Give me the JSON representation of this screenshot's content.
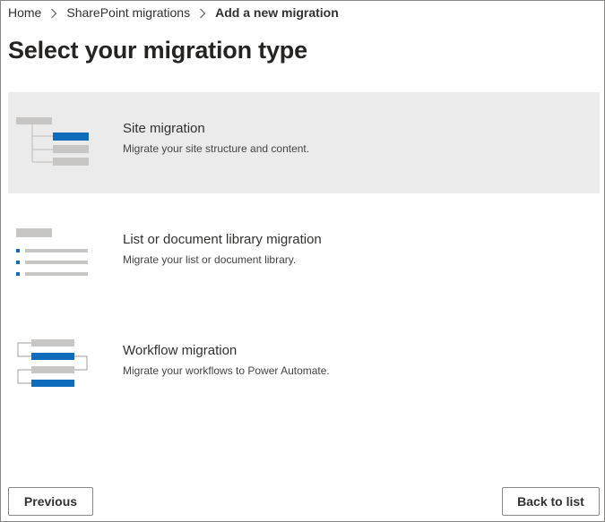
{
  "breadcrumb": {
    "items": [
      "Home",
      "SharePoint migrations",
      "Add a new migration"
    ]
  },
  "page": {
    "title": "Select your migration type"
  },
  "options": [
    {
      "title": "Site migration",
      "description": "Migrate your site structure and content.",
      "selected": true
    },
    {
      "title": "List or document library migration",
      "description": "Migrate your list or document library.",
      "selected": false
    },
    {
      "title": "Workflow migration",
      "description": "Migrate your workflows to Power Automate.",
      "selected": false
    }
  ],
  "footer": {
    "previous_label": "Previous",
    "back_label": "Back to list"
  },
  "colors": {
    "accent": "#0f6cbd",
    "placeholder_gray": "#c8c6c4",
    "selected_bg": "#ebebeb"
  },
  "icons": [
    "chevron-right-icon",
    "site-tree-icon",
    "list-icon",
    "workflow-icon"
  ]
}
